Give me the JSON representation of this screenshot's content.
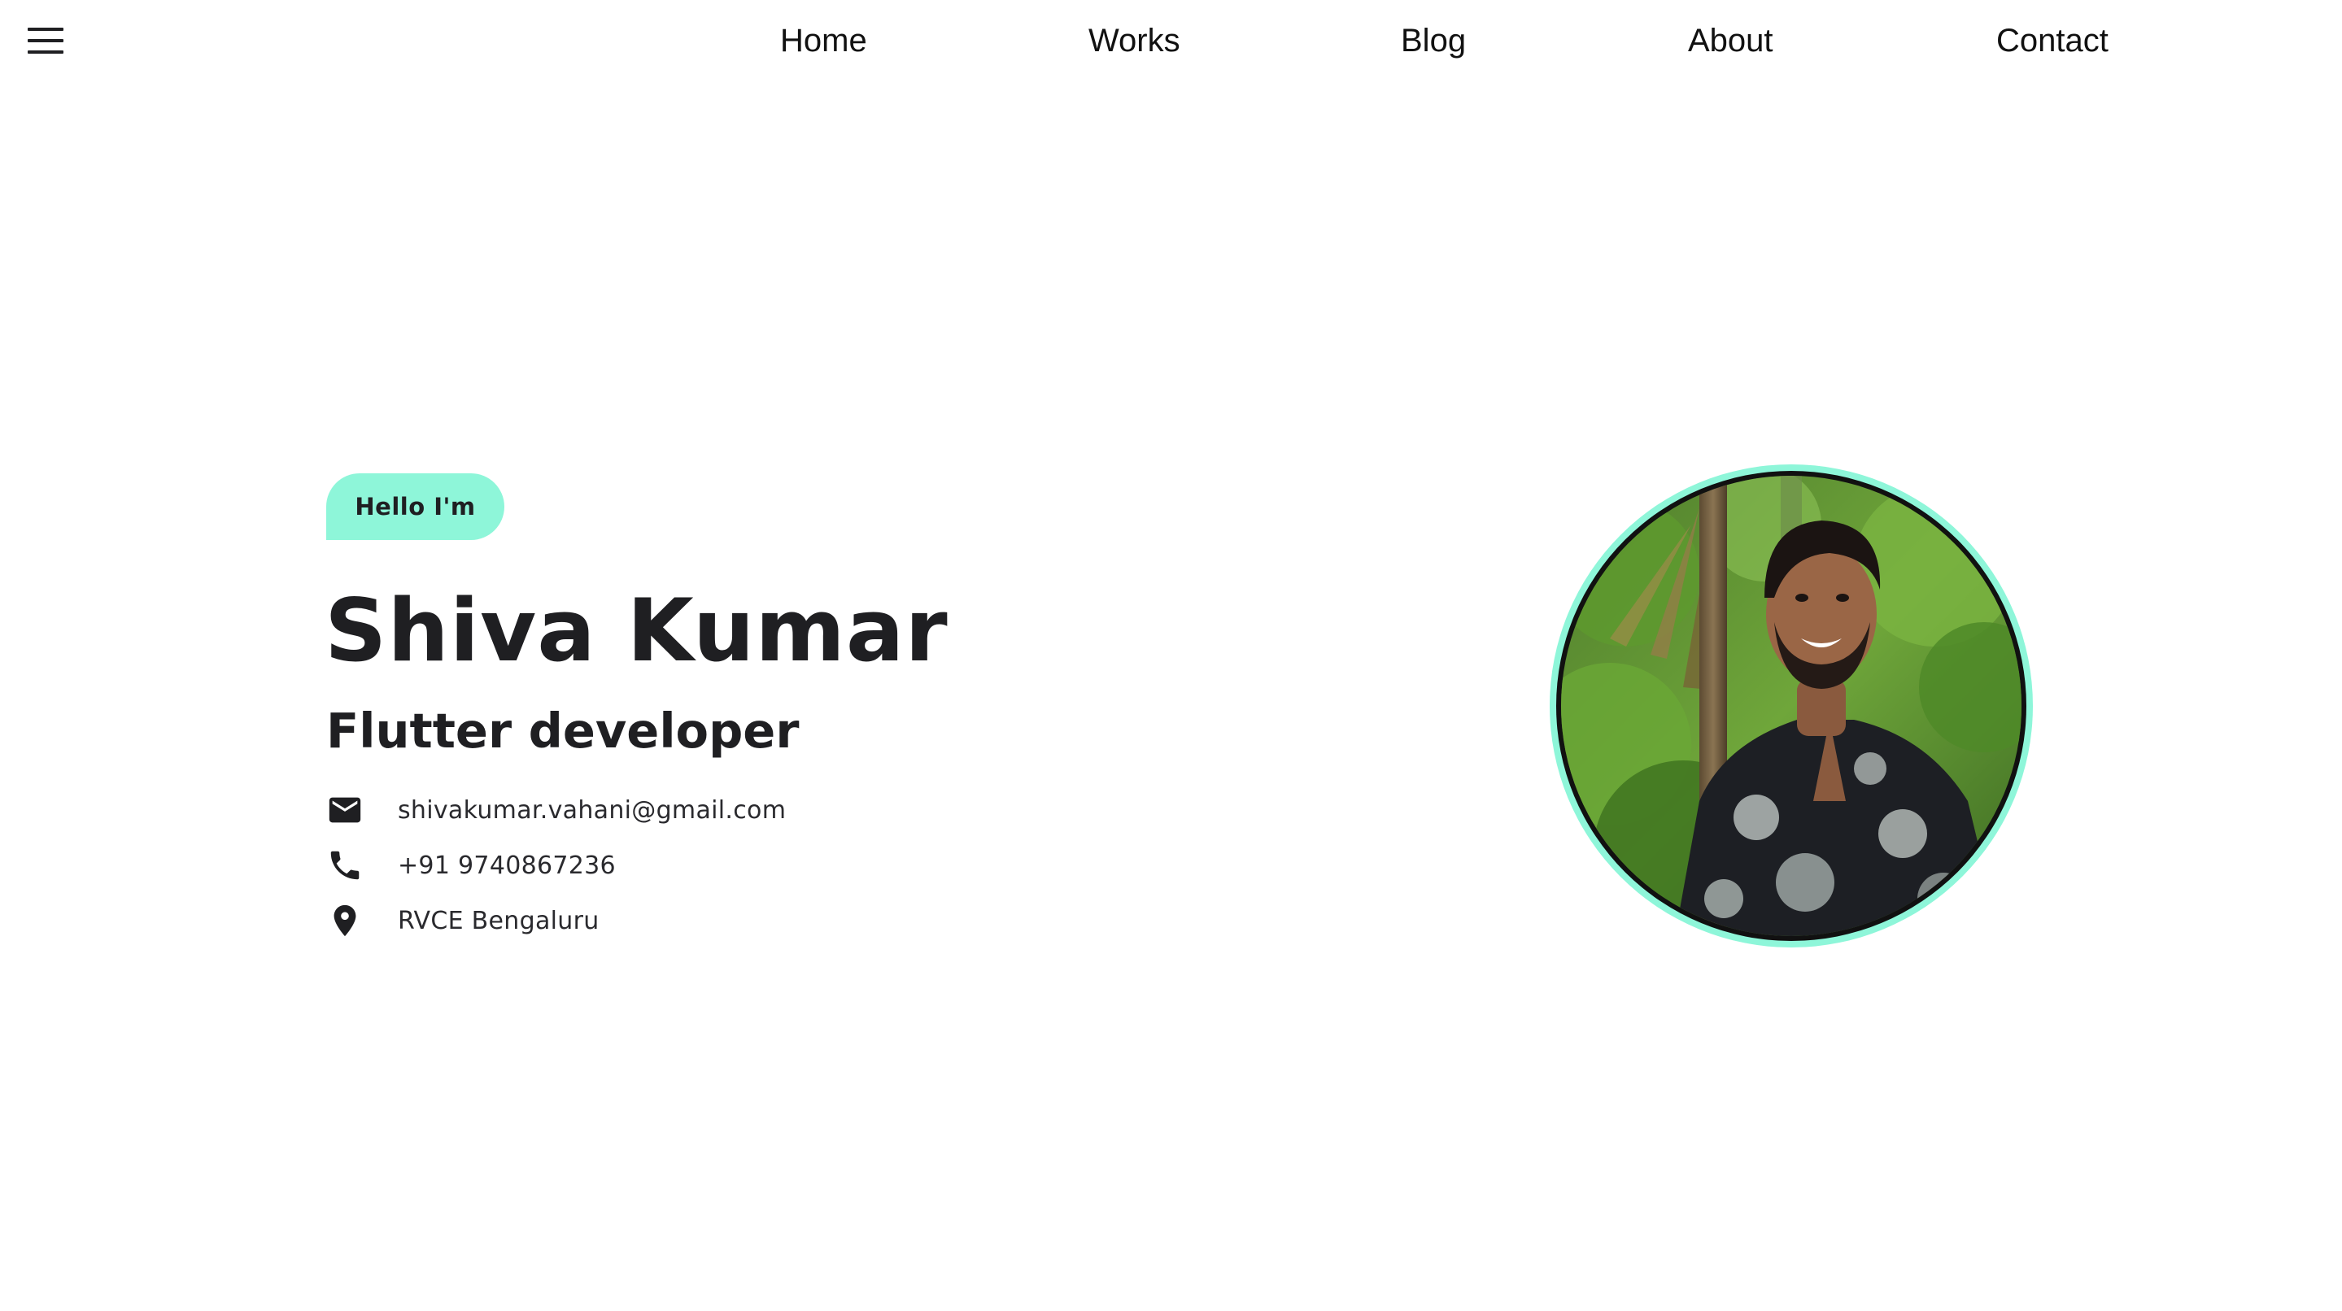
{
  "nav": {
    "menu_icon": "menu-icon",
    "links": [
      "Home",
      "Works",
      "Blog",
      "About",
      "Contact"
    ]
  },
  "hero": {
    "greeting": "Hello I'm",
    "name": "Shiva Kumar",
    "role": "Flutter developer",
    "contacts": [
      {
        "icon": "mail-icon",
        "text": "shivakumar.vahani@gmail.com"
      },
      {
        "icon": "phone-icon",
        "text": "+91 9740867236"
      },
      {
        "icon": "location-pin-icon",
        "text": "RVCE Bengaluru"
      }
    ]
  },
  "avatar": {
    "icon": "profile-photo"
  },
  "colors": {
    "accent": "#8ef6d9",
    "text": "#1f1f22",
    "background": "#ffffff"
  }
}
